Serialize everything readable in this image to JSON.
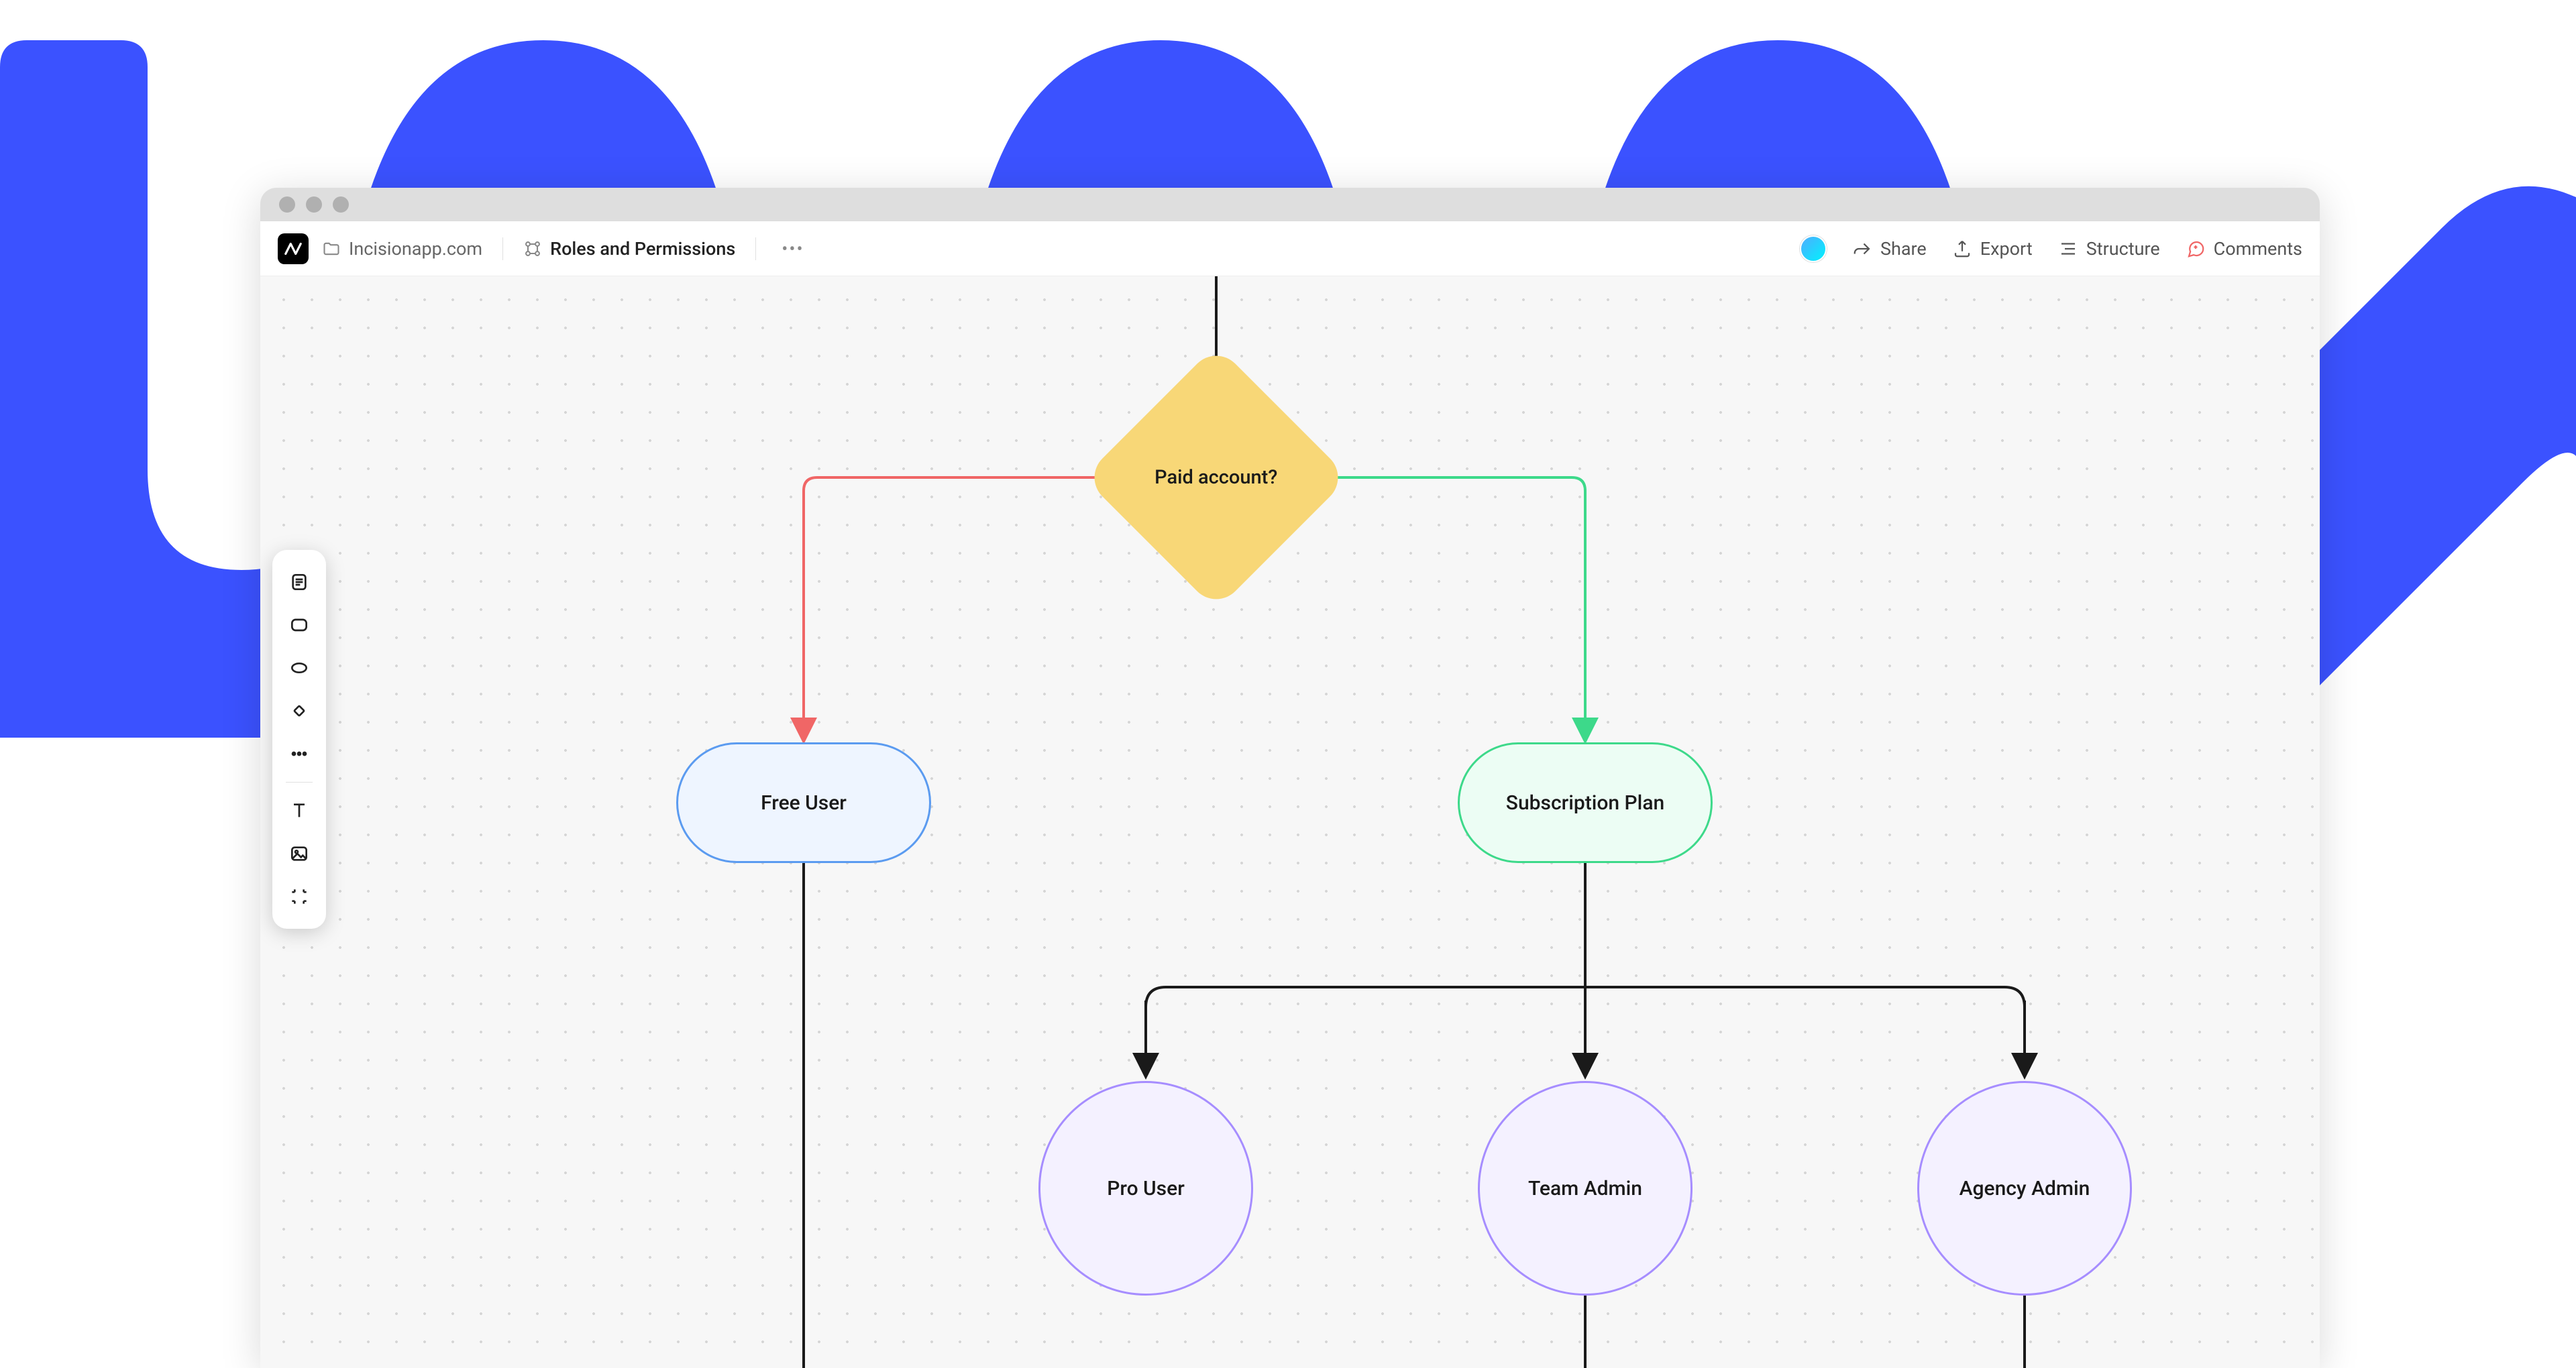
{
  "toolbar": {
    "project": "Incisionapp.com",
    "page": "Roles and Permissions",
    "share": "Share",
    "export": "Export",
    "structure": "Structure",
    "comments": "Comments"
  },
  "flow": {
    "decision": "Paid account?",
    "free_user": "Free User",
    "subscription": "Subscription Plan",
    "pro_user": "Pro User",
    "team_admin": "Team Admin",
    "agency_admin": "Agency Admin"
  },
  "colors": {
    "accent_blue": "#3b52ff",
    "diamond": "#f8d777",
    "pill_blue_border": "#5b9bf0",
    "pill_green_border": "#3dd98a",
    "circle_border": "#a68dff",
    "connector_red": "#f06666",
    "connector_green": "#3dd98a",
    "connector_black": "#1a1a1a"
  }
}
